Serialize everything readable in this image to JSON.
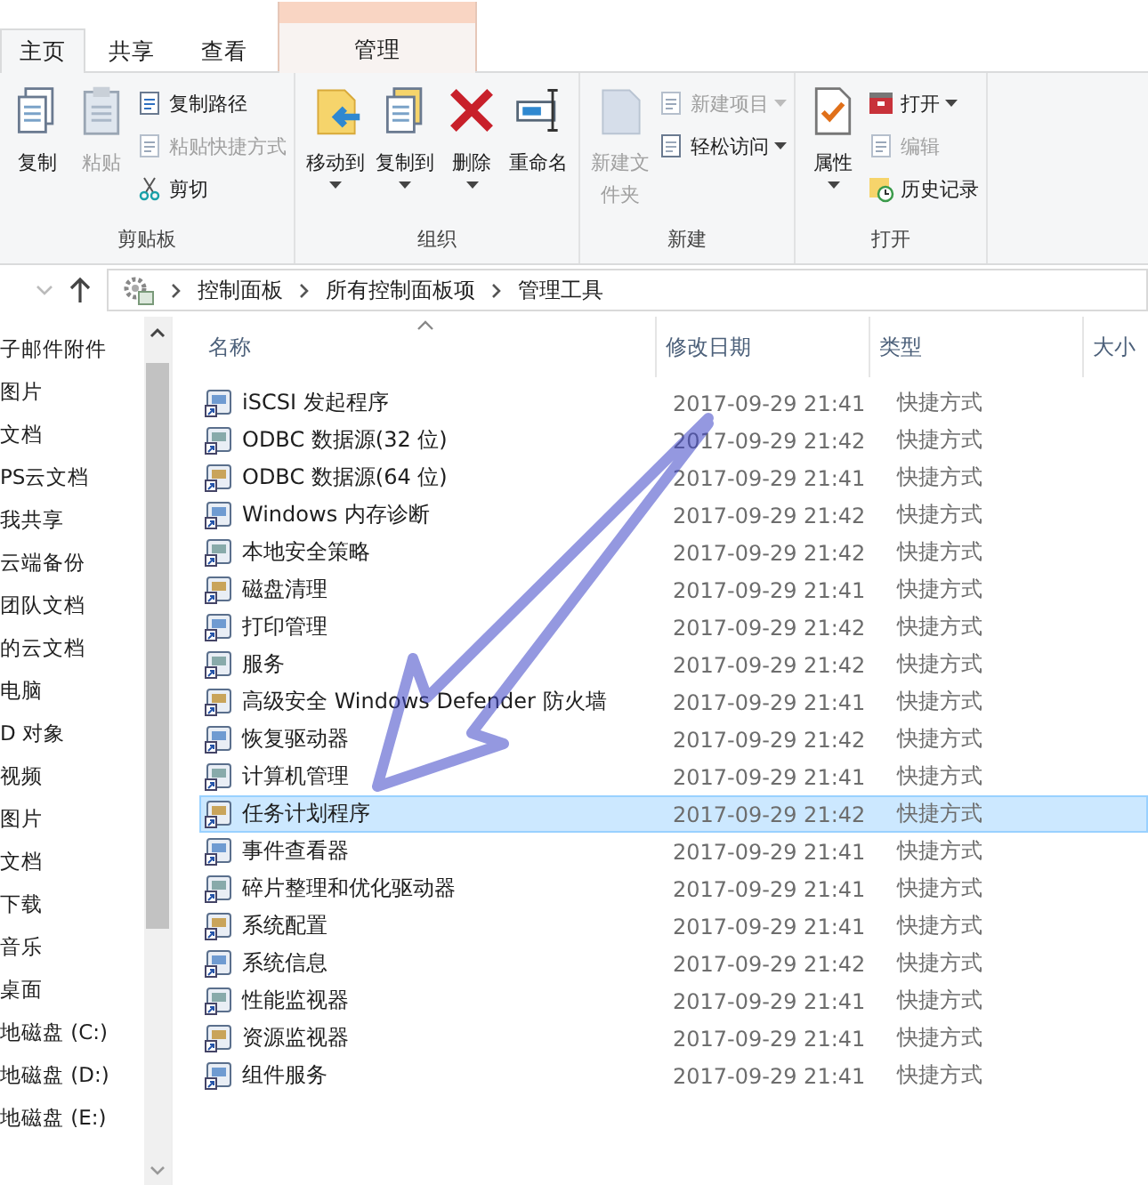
{
  "ribbon": {
    "tabs": [
      {
        "label": "主页",
        "selected": true,
        "kind": "plain"
      },
      {
        "label": "共享",
        "selected": false,
        "kind": "plain"
      },
      {
        "label": "查看",
        "selected": false,
        "kind": "plain"
      },
      {
        "label": "管理",
        "selected": false,
        "kind": "contextual"
      }
    ],
    "groups": [
      {
        "label": "剪贴板",
        "commands": [
          {
            "label": "复制",
            "kind": "large",
            "disabled": false,
            "dropdown": false
          },
          {
            "label": "粘贴",
            "kind": "large",
            "disabled": true,
            "dropdown": false
          },
          {
            "label": "复制路径",
            "kind": "small",
            "disabled": false,
            "dropdown": false
          },
          {
            "label": "粘贴快捷方式",
            "kind": "small",
            "disabled": true,
            "dropdown": false
          },
          {
            "label": "剪切",
            "kind": "small",
            "disabled": false,
            "dropdown": false
          }
        ]
      },
      {
        "label": "组织",
        "commands": [
          {
            "label": "移动到",
            "kind": "large",
            "disabled": false,
            "dropdown": true
          },
          {
            "label": "复制到",
            "kind": "large",
            "disabled": false,
            "dropdown": true
          },
          {
            "label": "删除",
            "kind": "large",
            "disabled": false,
            "dropdown": true
          },
          {
            "label": "重命名",
            "kind": "large",
            "disabled": false,
            "dropdown": false
          }
        ]
      },
      {
        "label": "新建",
        "commands": [
          {
            "label": "新建文件夹",
            "kind": "large",
            "disabled": true,
            "dropdown": false
          },
          {
            "label": "新建项目",
            "kind": "small",
            "disabled": true,
            "dropdown": true
          },
          {
            "label": "轻松访问",
            "kind": "small",
            "disabled": false,
            "dropdown": true
          }
        ]
      },
      {
        "label": "打开",
        "commands": [
          {
            "label": "属性",
            "kind": "large",
            "disabled": false,
            "dropdown": true
          },
          {
            "label": "打开",
            "kind": "small",
            "disabled": false,
            "dropdown": true
          },
          {
            "label": "编辑",
            "kind": "small",
            "disabled": true,
            "dropdown": false
          },
          {
            "label": "历史记录",
            "kind": "small",
            "disabled": false,
            "dropdown": false
          }
        ]
      }
    ]
  },
  "address_bar": {
    "breadcrumbs": [
      "控制面板",
      "所有控制面板项",
      "管理工具"
    ]
  },
  "sidebar": {
    "items": [
      "子邮件附件",
      "图片",
      "文档",
      "PS云文档",
      "我共享",
      "云端备份",
      "团队文档",
      "的云文档",
      "电脑",
      "D 对象",
      "视频",
      "图片",
      "文档",
      "下载",
      "音乐",
      "桌面",
      "地磁盘 (C:)",
      "地磁盘 (D:)",
      "地磁盘 (E:)"
    ]
  },
  "table": {
    "columns": [
      "名称",
      "修改日期",
      "类型",
      "大小"
    ],
    "rows": [
      {
        "name": "iSCSI 发起程序",
        "date": "2017-09-29 21:41",
        "type": "快捷方式",
        "selected": false
      },
      {
        "name": "ODBC 数据源(32 位)",
        "date": "2017-09-29 21:42",
        "type": "快捷方式",
        "selected": false
      },
      {
        "name": "ODBC 数据源(64 位)",
        "date": "2017-09-29 21:41",
        "type": "快捷方式",
        "selected": false
      },
      {
        "name": "Windows 内存诊断",
        "date": "2017-09-29 21:42",
        "type": "快捷方式",
        "selected": false
      },
      {
        "name": "本地安全策略",
        "date": "2017-09-29 21:42",
        "type": "快捷方式",
        "selected": false
      },
      {
        "name": "磁盘清理",
        "date": "2017-09-29 21:41",
        "type": "快捷方式",
        "selected": false
      },
      {
        "name": "打印管理",
        "date": "2017-09-29 21:42",
        "type": "快捷方式",
        "selected": false
      },
      {
        "name": "服务",
        "date": "2017-09-29 21:42",
        "type": "快捷方式",
        "selected": false
      },
      {
        "name": "高级安全 Windows Defender 防火墙",
        "date": "2017-09-29 21:41",
        "type": "快捷方式",
        "selected": false
      },
      {
        "name": "恢复驱动器",
        "date": "2017-09-29 21:42",
        "type": "快捷方式",
        "selected": false
      },
      {
        "name": "计算机管理",
        "date": "2017-09-29 21:41",
        "type": "快捷方式",
        "selected": false
      },
      {
        "name": "任务计划程序",
        "date": "2017-09-29 21:42",
        "type": "快捷方式",
        "selected": true
      },
      {
        "name": "事件查看器",
        "date": "2017-09-29 21:41",
        "type": "快捷方式",
        "selected": false
      },
      {
        "name": "碎片整理和优化驱动器",
        "date": "2017-09-29 21:41",
        "type": "快捷方式",
        "selected": false
      },
      {
        "name": "系统配置",
        "date": "2017-09-29 21:41",
        "type": "快捷方式",
        "selected": false
      },
      {
        "name": "系统信息",
        "date": "2017-09-29 21:42",
        "type": "快捷方式",
        "selected": false
      },
      {
        "name": "性能监视器",
        "date": "2017-09-29 21:41",
        "type": "快捷方式",
        "selected": false
      },
      {
        "name": "资源监视器",
        "date": "2017-09-29 21:41",
        "type": "快捷方式",
        "selected": false
      },
      {
        "name": "组件服务",
        "date": "2017-09-29 21:41",
        "type": "快捷方式",
        "selected": false
      }
    ]
  }
}
